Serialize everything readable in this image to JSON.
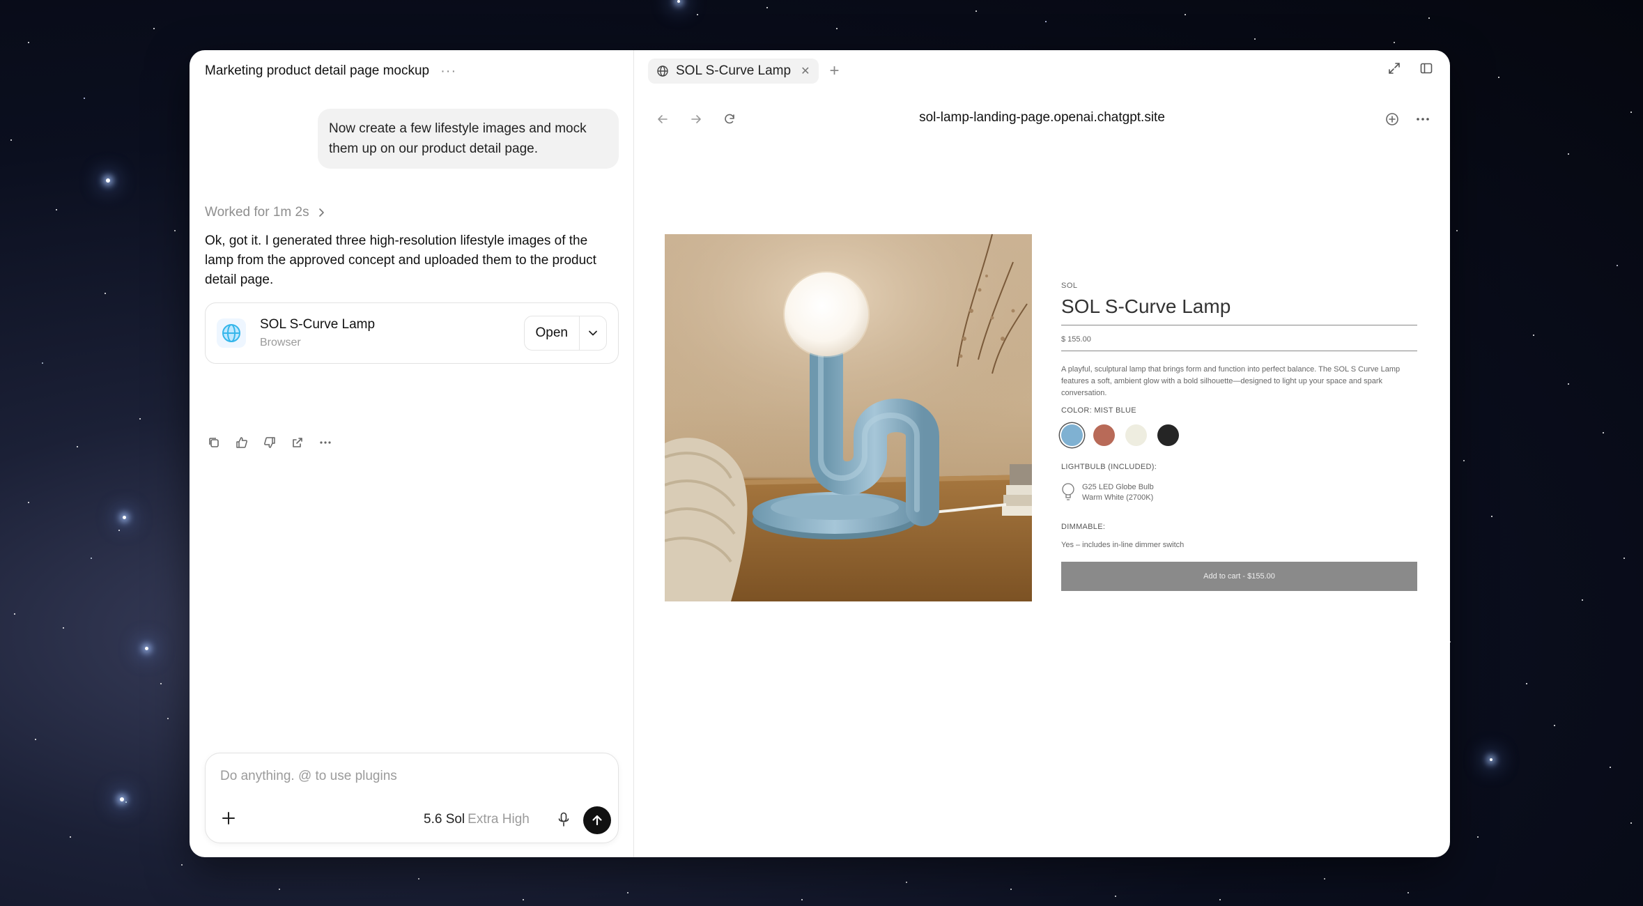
{
  "chat": {
    "title": "Marketing product detail page mockup",
    "user_message": "Now create a few lifestyle images and mock them up on our product detail page.",
    "worked_for": "Worked for 1m 2s",
    "assistant_reply": "Ok, got it. I generated three high-resolution lifestyle images of the lamp from the approved concept and uploaded them to the product detail page.",
    "card": {
      "title": "SOL S-Curve Lamp",
      "subtitle": "Browser",
      "open_label": "Open"
    },
    "composer": {
      "placeholder": "Do anything. @ to use plugins",
      "model": "5.6 Sol",
      "effort": "Extra High"
    }
  },
  "browser": {
    "tab_label": "SOL S-Curve Lamp",
    "url": "sol-lamp-landing-page.openai.chatgpt.site"
  },
  "product": {
    "brand": "SOL",
    "name": "SOL S-Curve Lamp",
    "price": "$ 155.00",
    "description": "A playful, sculptural lamp that brings form and function into perfect balance. The SOL S Curve Lamp features a soft, ambient glow with a bold silhouette—designed to light up your space and spark conversation.",
    "color_label": "COLOR: MIST BLUE",
    "swatches": [
      {
        "name": "Mist Blue",
        "color": "#7fb1d2",
        "selected": true
      },
      {
        "name": "Terracotta",
        "color": "#b86a58",
        "selected": false
      },
      {
        "name": "Cream",
        "color": "#eeede0",
        "selected": false
      },
      {
        "name": "Black",
        "color": "#252525",
        "selected": false
      }
    ],
    "lightbulb_label": "LIGHTBULB (INCLUDED):",
    "bulb_line1": "G25 LED Globe Bulb",
    "bulb_line2": "Warm White (2700K)",
    "dimmable_label": "DIMMABLE:",
    "dimmable_value": "Yes – includes in-line dimmer switch",
    "cart_label": "Add to cart - $155.00"
  },
  "icons": [
    "globe-icon",
    "close-icon",
    "plus-icon",
    "expand-icon",
    "sidebar-icon",
    "back-icon",
    "forward-icon",
    "reload-icon",
    "add-circle-icon",
    "more-icon",
    "chevron-right-icon",
    "chevron-down-icon",
    "copy-icon",
    "thumbs-up-icon",
    "thumbs-down-icon",
    "share-icon",
    "mic-icon",
    "send-arrow-icon",
    "lightbulb-icon"
  ]
}
